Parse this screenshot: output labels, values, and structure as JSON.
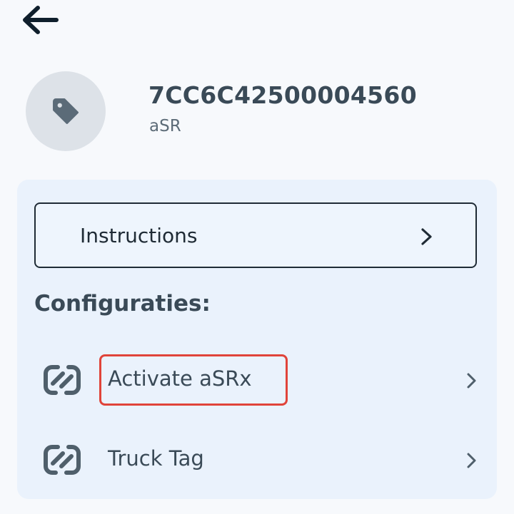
{
  "header": {
    "back_icon": "arrow-left-icon"
  },
  "device": {
    "id": "7CC6C42500004560",
    "type": "aSR",
    "icon": "tag-icon"
  },
  "panel": {
    "instructions_label": "Instructions",
    "section_title": "Configuraties:",
    "configs": [
      {
        "label": "Activate aSRx",
        "icon": "nfc-icon",
        "highlighted": true
      },
      {
        "label": "Truck Tag",
        "icon": "nfc-icon",
        "highlighted": false
      }
    ]
  },
  "colors": {
    "background": "#f7f9fc",
    "panel": "#eaf2fc",
    "text_dark": "#1f2b35",
    "text": "#3a4a57",
    "highlight": "#e0443a",
    "avatar": "#dde2e8"
  }
}
